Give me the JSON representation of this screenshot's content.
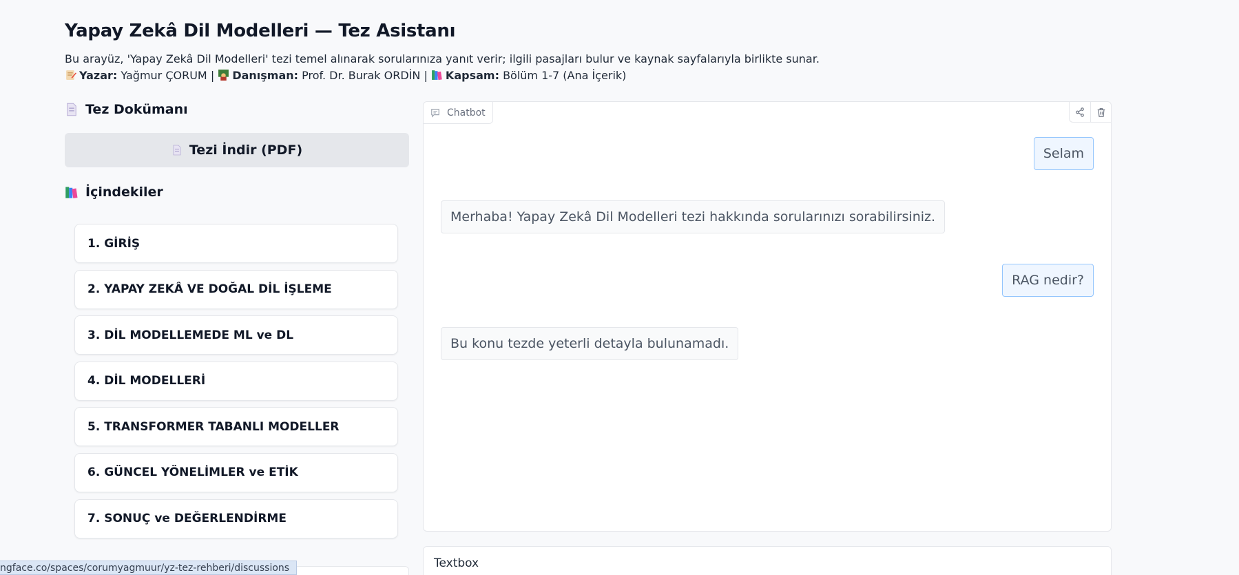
{
  "header": {
    "title": "Yapay Zekâ Dil Modelleri — Tez Asistanı",
    "description": "Bu arayüz, 'Yapay Zekâ Dil Modelleri' tezi temel alınarak sorularınıza yanıt verir; ilgili pasajları bulur ve kaynak sayfalarıyla birlikte sunar.",
    "author_label": "Yazar:",
    "author_value": "Yağmur ÇORUM",
    "advisor_label": "Danışman:",
    "advisor_value": "Prof. Dr. Burak ORDİN",
    "scope_label": "Kapsam:",
    "scope_value": "Bölüm 1-7 (Ana İçerik)",
    "separator": "|"
  },
  "sidebar": {
    "doc_title": "Tez Dokümanı",
    "download_label": "Tezi İndir (PDF)",
    "toc_title": "İçindekiler",
    "toc_items": [
      {
        "label": "1. GİRİŞ"
      },
      {
        "label": "2. YAPAY ZEKÂ VE DOĞAL DİL İŞLEME"
      },
      {
        "label": "3. DİL MODELLEMEDE ML ve DL"
      },
      {
        "label": "4. DİL MODELLERİ"
      },
      {
        "label": "5. TRANSFORMER TABANLI MODELLER"
      },
      {
        "label": "6. GÜNCEL YÖNELİMLER ve ETİK"
      },
      {
        "label": "7. SONUÇ ve DEĞERLENDİRME"
      }
    ]
  },
  "chatbot": {
    "label": "Chatbot",
    "messages": [
      {
        "role": "user",
        "text": "Selam"
      },
      {
        "role": "bot",
        "text": "Merhaba! Yapay Zekâ Dil Modelleri tezi hakkında sorularınızı sorabilirsiniz."
      },
      {
        "role": "user",
        "text": "RAG nedir?"
      },
      {
        "role": "bot",
        "text": "Bu konu tezde yeterli detayla bulunamadı."
      }
    ]
  },
  "textbox": {
    "label": "Textbox"
  },
  "status_bar": {
    "url": "ngface.co/spaces/corumyagmuur/yz-tez-rehberi/discussions"
  },
  "icons": {
    "author": "pencil-memo-icon",
    "advisor": "teacher-icon",
    "scope": "books-icon",
    "doc": "page-icon",
    "download": "page-icon",
    "toc": "books-icon",
    "chat": "chat-bubble-icon",
    "share": "share-icon",
    "delete": "trash-icon"
  },
  "colors": {
    "user_bubble_bg": "#eff6ff",
    "user_bubble_border": "#93c5fd",
    "bot_bubble_bg": "#f9fafb",
    "download_bg": "#e5e7eb"
  }
}
